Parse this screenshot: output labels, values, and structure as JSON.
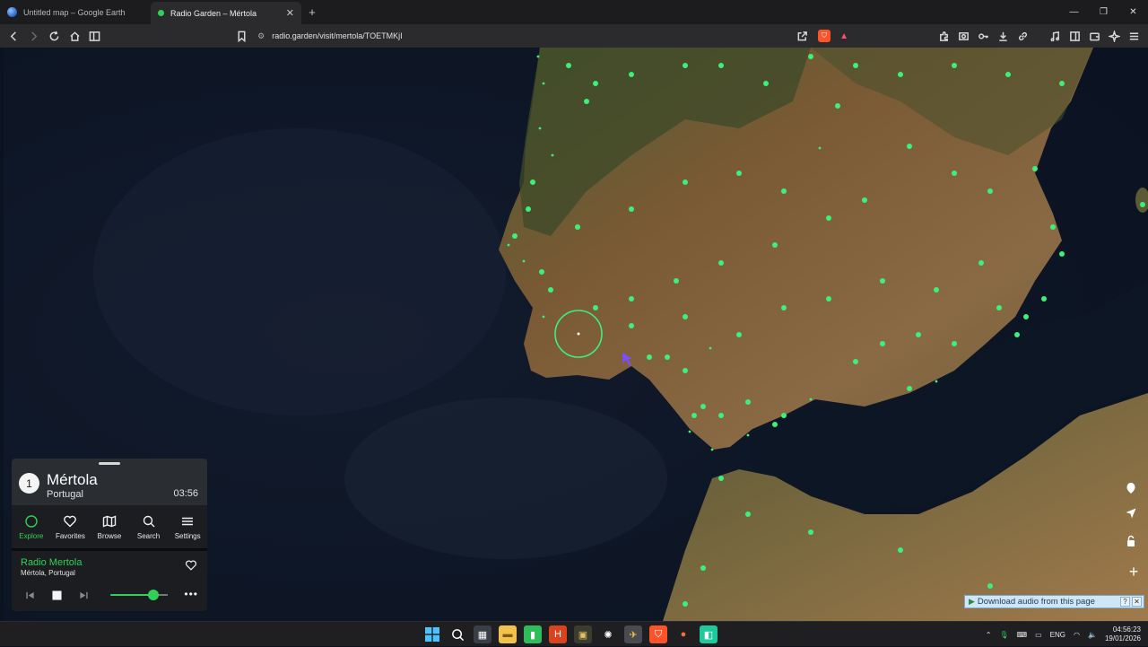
{
  "browser": {
    "tabs": [
      {
        "title": "Untitled map – Google Earth",
        "favicon": "google-earth-icon",
        "active": false
      },
      {
        "title": "Radio Garden – Mértola",
        "favicon": "audio-playing-icon",
        "active": true
      }
    ],
    "url": "radio.garden/visit/mertola/TOETMKjI"
  },
  "place": {
    "number": "1",
    "name": "Mértola",
    "country": "Portugal",
    "time": "03:56"
  },
  "nav": [
    {
      "label": "Explore",
      "icon": "explore-icon",
      "active": true
    },
    {
      "label": "Favorites",
      "icon": "heart-icon",
      "active": false
    },
    {
      "label": "Browse",
      "icon": "map-icon",
      "active": false
    },
    {
      "label": "Search",
      "icon": "search-icon",
      "active": false
    },
    {
      "label": "Settings",
      "icon": "menu-icon",
      "active": false
    }
  ],
  "player": {
    "station": "Radio Mertola",
    "location": "Mértola, Portugal",
    "volume_fraction": 0.75
  },
  "extension": {
    "download_label": "Download audio from this page"
  },
  "taskbar": {
    "language": "ENG",
    "time": "04:56:23",
    "date": "19/01/2026"
  },
  "colors": {
    "accent": "#30d158",
    "panel_head": "#2a2d31",
    "panel_body": "#1b1d20"
  }
}
